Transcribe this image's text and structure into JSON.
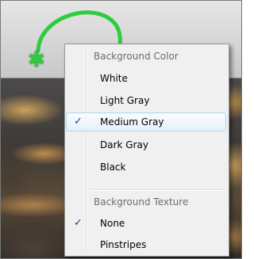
{
  "menu": {
    "background_color": {
      "header": "Background Color",
      "items": [
        {
          "label": "White",
          "checked": false
        },
        {
          "label": "Light Gray",
          "checked": false
        },
        {
          "label": "Medium Gray",
          "checked": true
        },
        {
          "label": "Dark Gray",
          "checked": false
        },
        {
          "label": "Black",
          "checked": false
        }
      ]
    },
    "background_texture": {
      "header": "Background Texture",
      "items": [
        {
          "label": "None",
          "checked": true
        },
        {
          "label": "Pinstripes",
          "checked": false
        }
      ]
    }
  },
  "icons": {
    "check": "✓",
    "cursor": "✱"
  },
  "colors": {
    "annotation_green": "#2ecc40",
    "menu_bg": "#f0f0f0",
    "highlight_border": "#a8d8eb"
  }
}
